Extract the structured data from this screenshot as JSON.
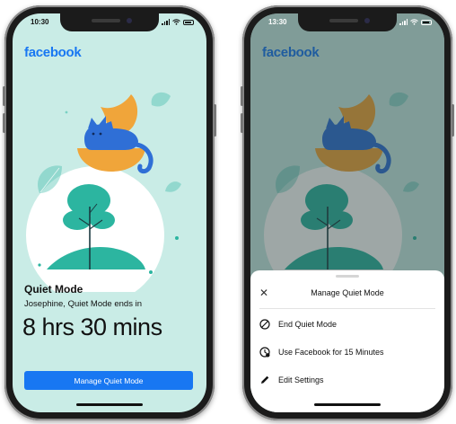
{
  "left_phone": {
    "status": {
      "time": "10:30"
    },
    "brand": "facebook",
    "title": "Quiet Mode",
    "subtitle": "Josephine, Quiet Mode ends in",
    "countdown": "8 hrs 30 mins",
    "button_label": "Manage Quiet Mode",
    "icons": [
      "signal-icon",
      "wifi-icon",
      "battery-icon"
    ]
  },
  "right_phone": {
    "status": {
      "time": "13:30"
    },
    "brand": "facebook",
    "sheet": {
      "close_icon": "close-icon",
      "title": "Manage Quiet Mode",
      "options": [
        {
          "label": "End Quiet Mode",
          "icon": "block-icon"
        },
        {
          "label": "Use Facebook for 15 Minutes",
          "icon": "clock-icon"
        },
        {
          "label": "Edit Settings",
          "icon": "pencil-icon"
        }
      ]
    }
  },
  "colors": {
    "screen_bg": "#c9ece6",
    "brand_blue": "#1877f2",
    "leaf": "#2cb5a0",
    "moon": "#f0a53a",
    "cat": "#2f6fd6"
  }
}
